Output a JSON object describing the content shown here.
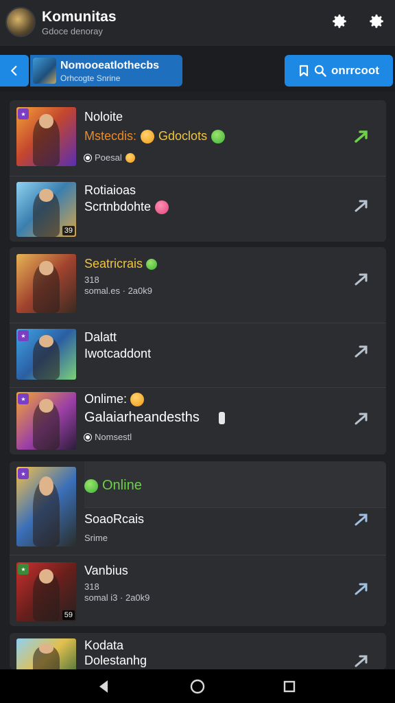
{
  "header": {
    "title": "Komunitas",
    "subtitle": "Gdoce denoray",
    "icons": [
      "gear-icon",
      "gear-icon"
    ]
  },
  "subbar": {
    "back_icon": "chevron-left-icon",
    "group_title": "Nomooeatlothecbs",
    "group_subtitle": "Orhcogte Snrine",
    "search_label": "onrrcoot",
    "search_icons": [
      "bookmark-icon",
      "search-icon"
    ]
  },
  "colors": {
    "accent": "#1e88e5",
    "background": "#1f2023",
    "card": "#2b2d31",
    "orange_text": "#f08a24",
    "green_text": "#6ed04a",
    "yellow_text": "#f0c544"
  },
  "groups": [
    {
      "items": [
        {
          "name": "Noloite",
          "line2a": "Mstecdis:",
          "line2b": "Gdoclots",
          "status": "Poesal",
          "badge": ""
        },
        {
          "name": "Rotiaioas",
          "line2a": "Scrtnbdohte",
          "badge": "39"
        }
      ]
    },
    {
      "items": [
        {
          "name": "Seatricrais",
          "meta1": "318",
          "meta2": "somal.es · 2a0k9"
        },
        {
          "name": "Dalatt",
          "line2a": "Iwotcaddont"
        },
        {
          "name": "Onlime:",
          "line2a": "Galaiarheandesths",
          "status": "Nomsestl"
        }
      ]
    },
    {
      "items": [
        {
          "name": "Online",
          "line2a": "SoaoRcais",
          "meta1": "Srime"
        },
        {
          "name": "Vanbius",
          "meta1": "318",
          "meta2": "somal i3 · 2a0k9",
          "badge": "59"
        }
      ]
    },
    {
      "items": [
        {
          "name": "Kodata",
          "line2a": "Dolestanhg"
        }
      ]
    }
  ],
  "navbar": {
    "icons": [
      "back-triangle-icon",
      "home-circle-icon",
      "recents-square-icon"
    ]
  }
}
